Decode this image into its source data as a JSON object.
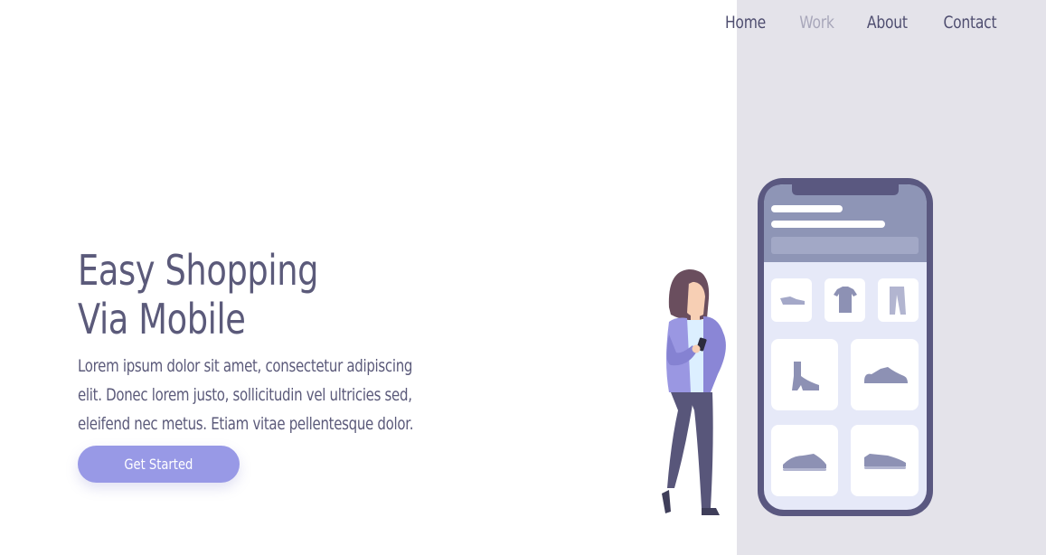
{
  "nav": {
    "items": [
      {
        "label": "Home",
        "active": false
      },
      {
        "label": "Work",
        "active": true
      },
      {
        "label": "About",
        "active": false
      },
      {
        "label": "Contact",
        "active": false
      }
    ]
  },
  "hero": {
    "title_line1": "Easy Shopping",
    "title_line2": "Via Mobile",
    "text_line1": "Lorem ipsum dolor sit amet, consectetur adipiscing",
    "text_line2": "elit. Donec lorem justo, sollicitudin vel ultricies sed,",
    "text_line3": "eleifend nec metus. Etiam vitae pellentesque dolor.",
    "cta_label": "Get Started"
  },
  "colors": {
    "text": "#5b5a7a",
    "accent": "#9899e6",
    "panel": "#e4e3ea",
    "nav_active": "#a8a7ba",
    "phone_frame": "#5a5880"
  },
  "illustration": {
    "icons": [
      "flat-shoe-icon",
      "tshirt-icon",
      "pants-icon",
      "boot-icon",
      "sneaker-icon",
      "running-shoe-icon",
      "loafer-icon"
    ]
  }
}
